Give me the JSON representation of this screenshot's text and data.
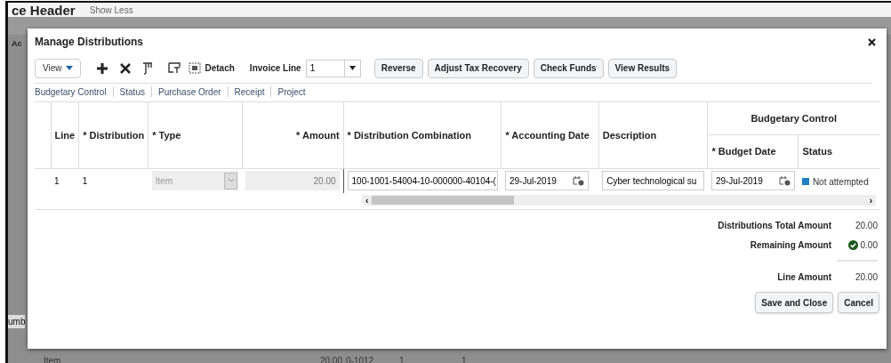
{
  "background": {
    "header_title": "ce Header",
    "show_less": "Show Less",
    "side_texts": [
      "Ac",
      "umb"
    ],
    "bottom_row": [
      "Item",
      "20.00",
      "0-1012",
      "1",
      "1"
    ]
  },
  "dialog": {
    "title": "Manage Distributions",
    "toolbar": {
      "view_menu": "View",
      "detach": "Detach",
      "invoice_line_label": "Invoice Line",
      "invoice_line_value": "1",
      "buttons": [
        "Reverse",
        "Adjust Tax Recovery",
        "Check Funds",
        "View Results"
      ]
    },
    "links": [
      "Budgetary Control",
      "Status",
      "Purchase Order",
      "Receipt",
      "Project"
    ],
    "table": {
      "group_header": "Budgetary Control",
      "columns": [
        "Line",
        "* Distribution",
        "* Type",
        "* Amount",
        "* Distribution Combination",
        "* Accounting Date",
        "Description",
        "* Budget Date",
        "Status"
      ],
      "scroll_left": "‹",
      "scroll_right": "›",
      "rows": [
        {
          "line": "1",
          "distribution": "1",
          "type": "Item",
          "amount": "20.00",
          "distribution_combination": "100-1001-54004-10-000000-40104-(",
          "accounting_date": "29-Jul-2019",
          "description": "Cyber technological su",
          "budget_date": "29-Jul-2019",
          "status": "Not attempted",
          "color": "#1f7fc4"
        }
      ]
    },
    "totals": [
      {
        "label": "Distributions Total Amount",
        "value": "20.00",
        "kind": "plain"
      },
      {
        "label": "Remaining Amount",
        "value": "0.00",
        "kind": "check"
      },
      {
        "label": "Line Amount",
        "value": "20.00",
        "kind": "separated"
      }
    ],
    "buttons": [
      "Save and Close",
      "Cancel"
    ]
  }
}
